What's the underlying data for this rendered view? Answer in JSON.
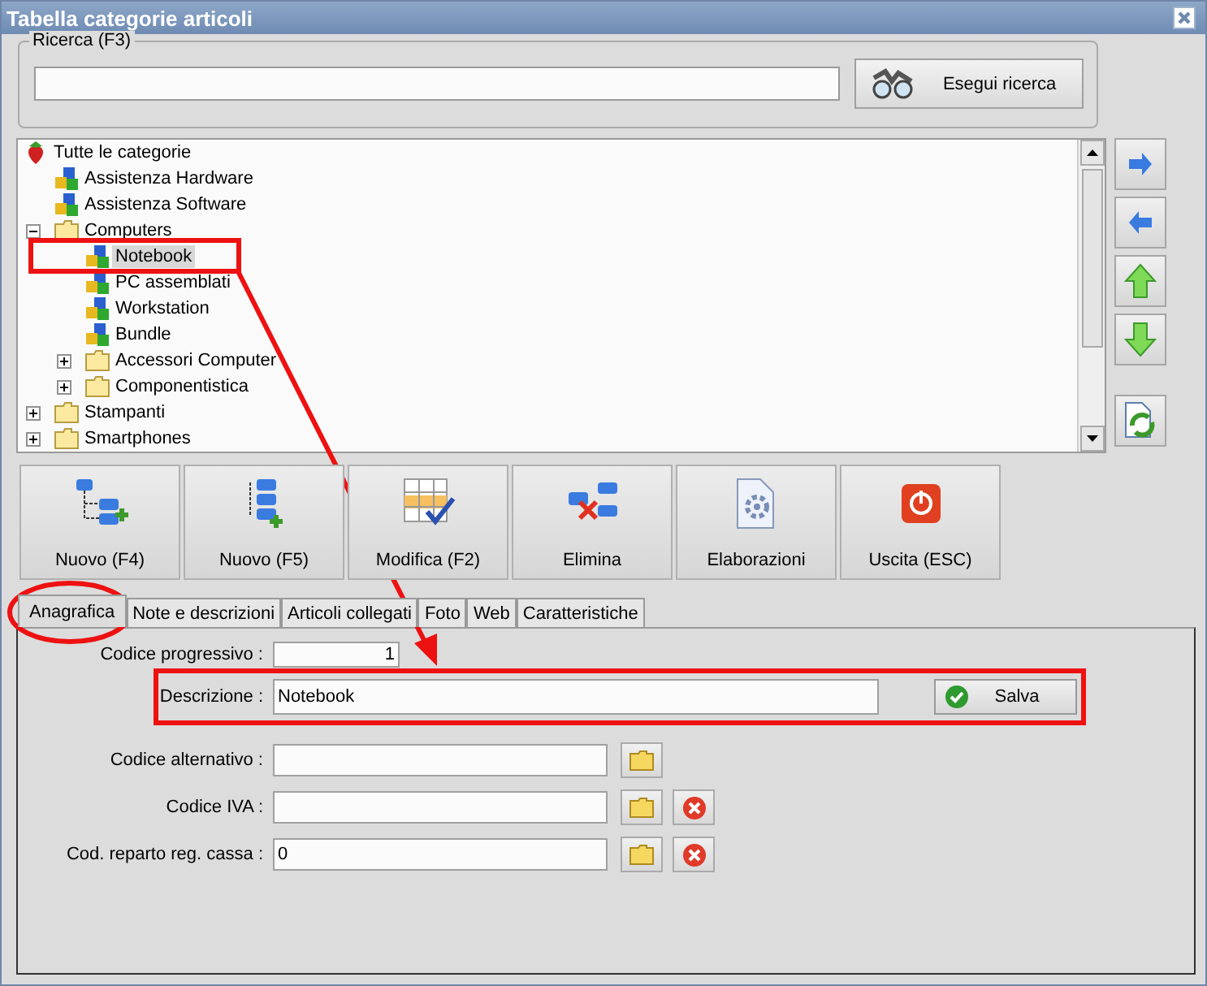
{
  "window": {
    "title": "Tabella categorie articoli"
  },
  "search": {
    "legend": "Ricerca (F3)",
    "button": "Esegui ricerca"
  },
  "tree": [
    {
      "label": "Tutte le categorie",
      "kind": "root",
      "selected": false,
      "children": [
        {
          "label": "Assistenza Hardware",
          "kind": "category",
          "selected": false
        },
        {
          "label": "Assistenza Software",
          "kind": "category",
          "selected": false
        },
        {
          "label": "Computers",
          "kind": "folder",
          "expanded": true,
          "selected": false,
          "children": [
            {
              "label": "Notebook",
              "kind": "category",
              "selected": true
            },
            {
              "label": "PC assemblati",
              "kind": "category",
              "selected": false
            },
            {
              "label": "Workstation",
              "kind": "category",
              "selected": false
            },
            {
              "label": "Bundle",
              "kind": "category",
              "selected": false
            },
            {
              "label": "Accessori Computer",
              "kind": "folder",
              "expanded": false,
              "selected": false
            },
            {
              "label": "Componentistica",
              "kind": "folder",
              "expanded": false,
              "selected": false
            }
          ]
        },
        {
          "label": "Stampanti",
          "kind": "folder",
          "expanded": false,
          "selected": false
        },
        {
          "label": "Smartphones",
          "kind": "folder",
          "expanded": false,
          "selected": false
        }
      ]
    }
  ],
  "toolbar": [
    {
      "label": "Nuovo (F4)",
      "kind": "new-sibling"
    },
    {
      "label": "Nuovo (F5)",
      "kind": "new-child"
    },
    {
      "label": "Modifica (F2)",
      "kind": "edit"
    },
    {
      "label": "Elimina",
      "kind": "delete"
    },
    {
      "label": "Elaborazioni",
      "kind": "process"
    },
    {
      "label": "Uscita (ESC)",
      "kind": "exit"
    }
  ],
  "tabs": [
    {
      "label": "Anagrafica",
      "selected": true
    },
    {
      "label": "Note e descrizioni",
      "selected": false
    },
    {
      "label": "Articoli collegati",
      "selected": false
    },
    {
      "label": "Foto",
      "selected": false
    },
    {
      "label": "Web",
      "selected": false
    },
    {
      "label": "Caratteristiche",
      "selected": false
    }
  ],
  "form": [
    {
      "label": "Codice progressivo :",
      "value": "1",
      "kind": "number"
    },
    {
      "label": "Descrizione :",
      "value": "Notebook",
      "kind": "save",
      "button": "Salva"
    },
    {
      "label": "Codice alternativo :",
      "kind": "lookup"
    },
    {
      "label": "Codice IVA :",
      "kind": "lookup-clear"
    },
    {
      "label": "Cod. reparto reg. cassa :",
      "value": "0",
      "kind": "lookup-clear"
    }
  ]
}
